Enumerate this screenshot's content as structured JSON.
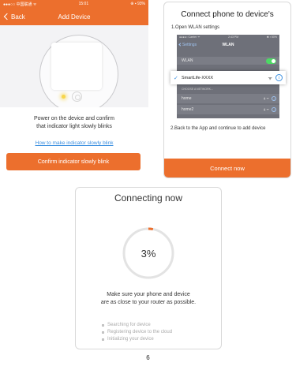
{
  "colors": {
    "accent": "#ec6f2d",
    "link": "#3b8fe0",
    "wifi_toggle": "#4cd964"
  },
  "left_screen": {
    "status": {
      "carrier": "●●●○○ 中国联通 ᯤ",
      "time": "15:01",
      "right": "⊕ ▪ 93%"
    },
    "nav": {
      "back_label": "Back",
      "title": "Add Device"
    },
    "instruction_line1": "Power on the device and confirm",
    "instruction_line2": "that indicator light slowly blinks",
    "help_link": "How to make indicator slowly blink",
    "confirm_button": "Confirm indicator slowly blink"
  },
  "right_card": {
    "title": "Connect phone to device's",
    "step1": "1.Open WLAN settings",
    "screenshot": {
      "status_left": "●●●●○ Carrier ᯤ",
      "status_time": "2:43 PM",
      "status_right": "✱ ▪ 50%",
      "back_label": "Settings",
      "title": "WLAN",
      "wlan_label": "WLAN",
      "selected_network": "SmartLife-XXXX",
      "choose_header": "CHOOSE A NETWORK...",
      "networks": [
        {
          "name": "home"
        },
        {
          "name": "home2"
        }
      ]
    },
    "step2": "2.Back to the App and continue to add device",
    "connect_button": "Connect now"
  },
  "bottom_card": {
    "title": "Connecting now",
    "progress": {
      "value": 0.03,
      "label": "3%"
    },
    "advice_line1": "Make sure your phone and device",
    "advice_line2": "are as close to your router as possible.",
    "steps": [
      "Searching for device",
      "Registering device to the cloud",
      "Initializing your device"
    ]
  },
  "page_number": "6"
}
